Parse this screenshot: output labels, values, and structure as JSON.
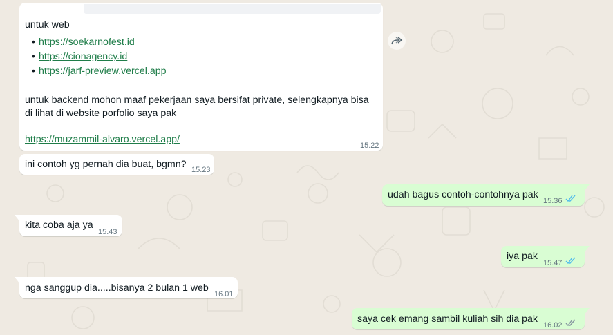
{
  "messages": {
    "m1": {
      "intro": "untuk web",
      "links": [
        "https://soekarnofest.id",
        "https://cionagency.id",
        "https://jarf-preview.vercel.app"
      ],
      "line1": "untuk backend mohon maaf pekerjaan saya bersifat private, selengkapnya bisa",
      "line2": "di lihat di website porfolio saya pak",
      "portfolio_link": "https://muzammil-alvaro.vercel.app/",
      "time": "15.22"
    },
    "m2": {
      "text": "ini contoh yg pernah dia buat, bgmn?",
      "time": "15.23"
    },
    "m3": {
      "text": "udah bagus contoh-contohnya pak",
      "time": "15.36"
    },
    "m4": {
      "text": "kita coba aja ya",
      "time": "15.43"
    },
    "m5": {
      "text": "iya pak",
      "time": "15.47"
    },
    "m6": {
      "text": "nga sanggup dia.....bisanya 2 bulan 1 web",
      "time": "16.01"
    },
    "m7": {
      "text": "saya cek emang sambil kuliah sih dia pak",
      "time": "16.02"
    }
  },
  "colors": {
    "wallpaper": "#efeae2",
    "incoming": "#ffffff",
    "outgoing": "#d9fdd3",
    "link": "#1f7d49",
    "read_ticks": "#53bdeb"
  },
  "icons": {
    "forward": "forward-arrow-icon",
    "read_status": "double-check-icon"
  }
}
